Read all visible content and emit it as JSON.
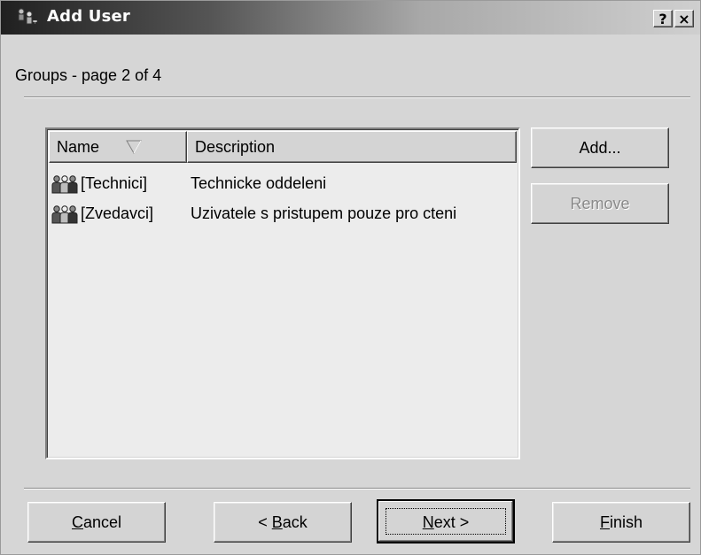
{
  "window": {
    "title": "Add User",
    "help_button": "?",
    "close_button": "×"
  },
  "page_label": "Groups - page 2 of 4",
  "listview": {
    "columns": [
      {
        "label": "Name",
        "sorted": true
      },
      {
        "label": "Description",
        "sorted": false
      }
    ],
    "rows": [
      {
        "icon": "group-icon",
        "name": "[Technici]",
        "description": "Technicke oddeleni"
      },
      {
        "icon": "group-icon",
        "name": "[Zvedavci]",
        "description": "Uzivatele s pristupem pouze pro cteni"
      }
    ]
  },
  "side_buttons": {
    "add": "Add...",
    "remove": "Remove",
    "remove_enabled": false
  },
  "footer": {
    "cancel": {
      "accel": "C",
      "rest": "ancel"
    },
    "back": {
      "pre": "< ",
      "accel": "B",
      "rest": "ack"
    },
    "next": {
      "accel": "N",
      "rest": "ext >"
    },
    "finish": {
      "accel": "F",
      "rest": "inish"
    }
  }
}
